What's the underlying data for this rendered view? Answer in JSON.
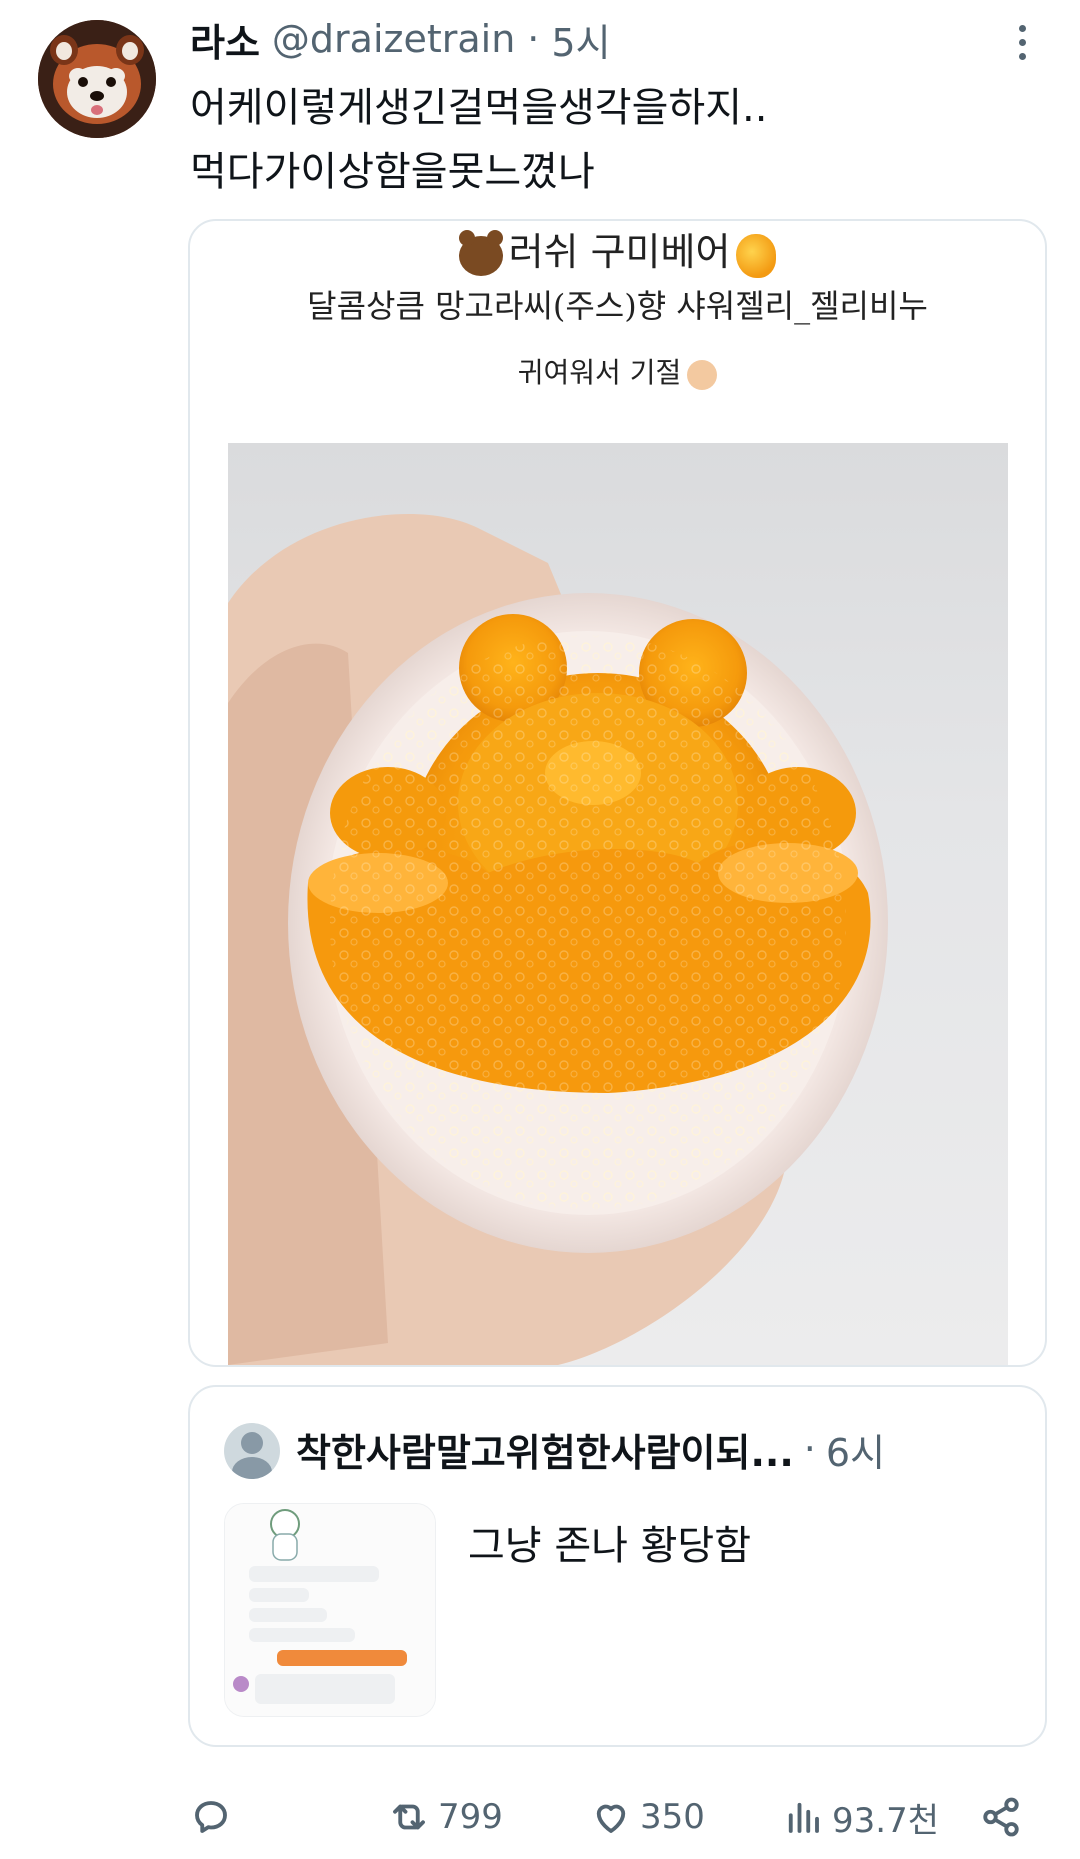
{
  "tweet": {
    "display_name": "라소",
    "handle": "@draizetrain",
    "separator": "·",
    "time": "5시",
    "text_lines": [
      "어케이렇게생긴걸먹을생각을하지..",
      "먹다가이상함을못느꼈나"
    ],
    "avatar_icon": "red-panda-avatar",
    "more_icon": "more-vertical-icon"
  },
  "media": {
    "caption_line1": "러쉬 구미베어",
    "caption_line2": "달콤상큼 망고라씨(주스)향 샤워젤리_젤리비누",
    "caption_line3": "귀여워서 기절",
    "emojis": [
      "bear-emoji",
      "mango-emoji",
      "person-emoji"
    ],
    "photo_description_icon": "orange-gummy-bear-jelly-in-cup-photo"
  },
  "quote": {
    "display_name": "착한사람말고위험한사람이되...",
    "separator": "·",
    "time": "6시",
    "text": "그냥 존나 황당함",
    "thumbnail_icon": "chat-screenshot-thumbnail"
  },
  "actions": {
    "reply_icon": "reply-icon",
    "retweet_icon": "retweet-icon",
    "retweets": "799",
    "like_icon": "heart-icon",
    "likes": "350",
    "views_icon": "views-icon",
    "views": "93.7천",
    "share_icon": "share-icon"
  },
  "colors": {
    "text_primary": "#0f1419",
    "text_secondary": "#536471",
    "border": "#e1e8ed",
    "jelly_orange": "#f39a12"
  }
}
